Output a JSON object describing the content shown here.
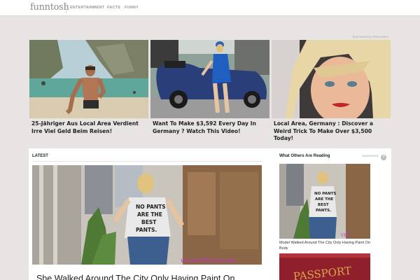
{
  "header": {
    "logo_text": "funntosh",
    "nav": [
      "ENTERTAINMENT",
      "FACTS",
      "FUNNY"
    ]
  },
  "sponsored_row": {
    "label": "Sponsored by Revcontent",
    "cards": [
      {
        "title": "25-Jähriger Aus Local Area Verdient Irre Viel Geld Beim Reisen!",
        "image": "man-on-beach-photo"
      },
      {
        "title": "Want To Make $3,592 Every Day In Germany ? Watch This Video!",
        "image": "woman-with-blue-car-photo"
      },
      {
        "title": "Local Area, Germany : Discover a Weird Trick To Make Over $3,500 Today!",
        "image": "blonde-woman-portrait-photo"
      }
    ]
  },
  "main": {
    "section_label": "LATEST",
    "hero": {
      "image": "woman-city-street-photo",
      "shirt_text": "NO PANTS ARE THE BEST PANTS.",
      "watermark": "www.VH3com.hk",
      "title": "She Walked Around The City Only Having Paint On"
    }
  },
  "aside": {
    "title": "What Others Are Reading",
    "sponsored_label": "Sponsored",
    "help_icon": "?",
    "item": {
      "image": "woman-city-street-photo-small",
      "shirt_text": "NO PANTS ARE THE BEST PANTS.",
      "caption": "Model Walked Around The City Only Having Paint On Body"
    },
    "next_item_image": "passport-photo",
    "next_item_image_text": "PASSPORT"
  },
  "colors": {
    "page_bg": "#e9e4e4",
    "card_bg": "#ffffff"
  }
}
